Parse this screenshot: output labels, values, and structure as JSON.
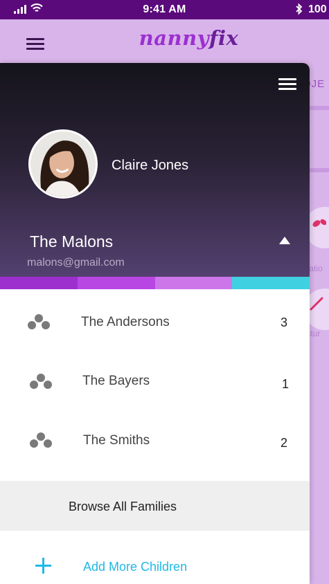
{
  "status_bar": {
    "time": "9:41 AM",
    "battery_text": "100"
  },
  "header": {
    "logo_part1": "nanny",
    "logo_part2": "fix"
  },
  "background": {
    "tab_label": "OJE",
    "medication_label": "dicatio",
    "temperature_label": "eratur"
  },
  "drawer": {
    "profile_name": "Claire Jones",
    "selected_family": "The Malons",
    "selected_email": "malons@gmail.com",
    "strip_colors": [
      "#9d2fcf",
      "#b846e3",
      "#cc76ea",
      "#3fd0e2"
    ],
    "families": [
      {
        "name": "The Andersons",
        "count": "3"
      },
      {
        "name": "The Bayers",
        "count": "1"
      },
      {
        "name": "The Smiths",
        "count": "2"
      }
    ],
    "browse_label": "Browse All Families",
    "add_label": "Add More Children"
  }
}
